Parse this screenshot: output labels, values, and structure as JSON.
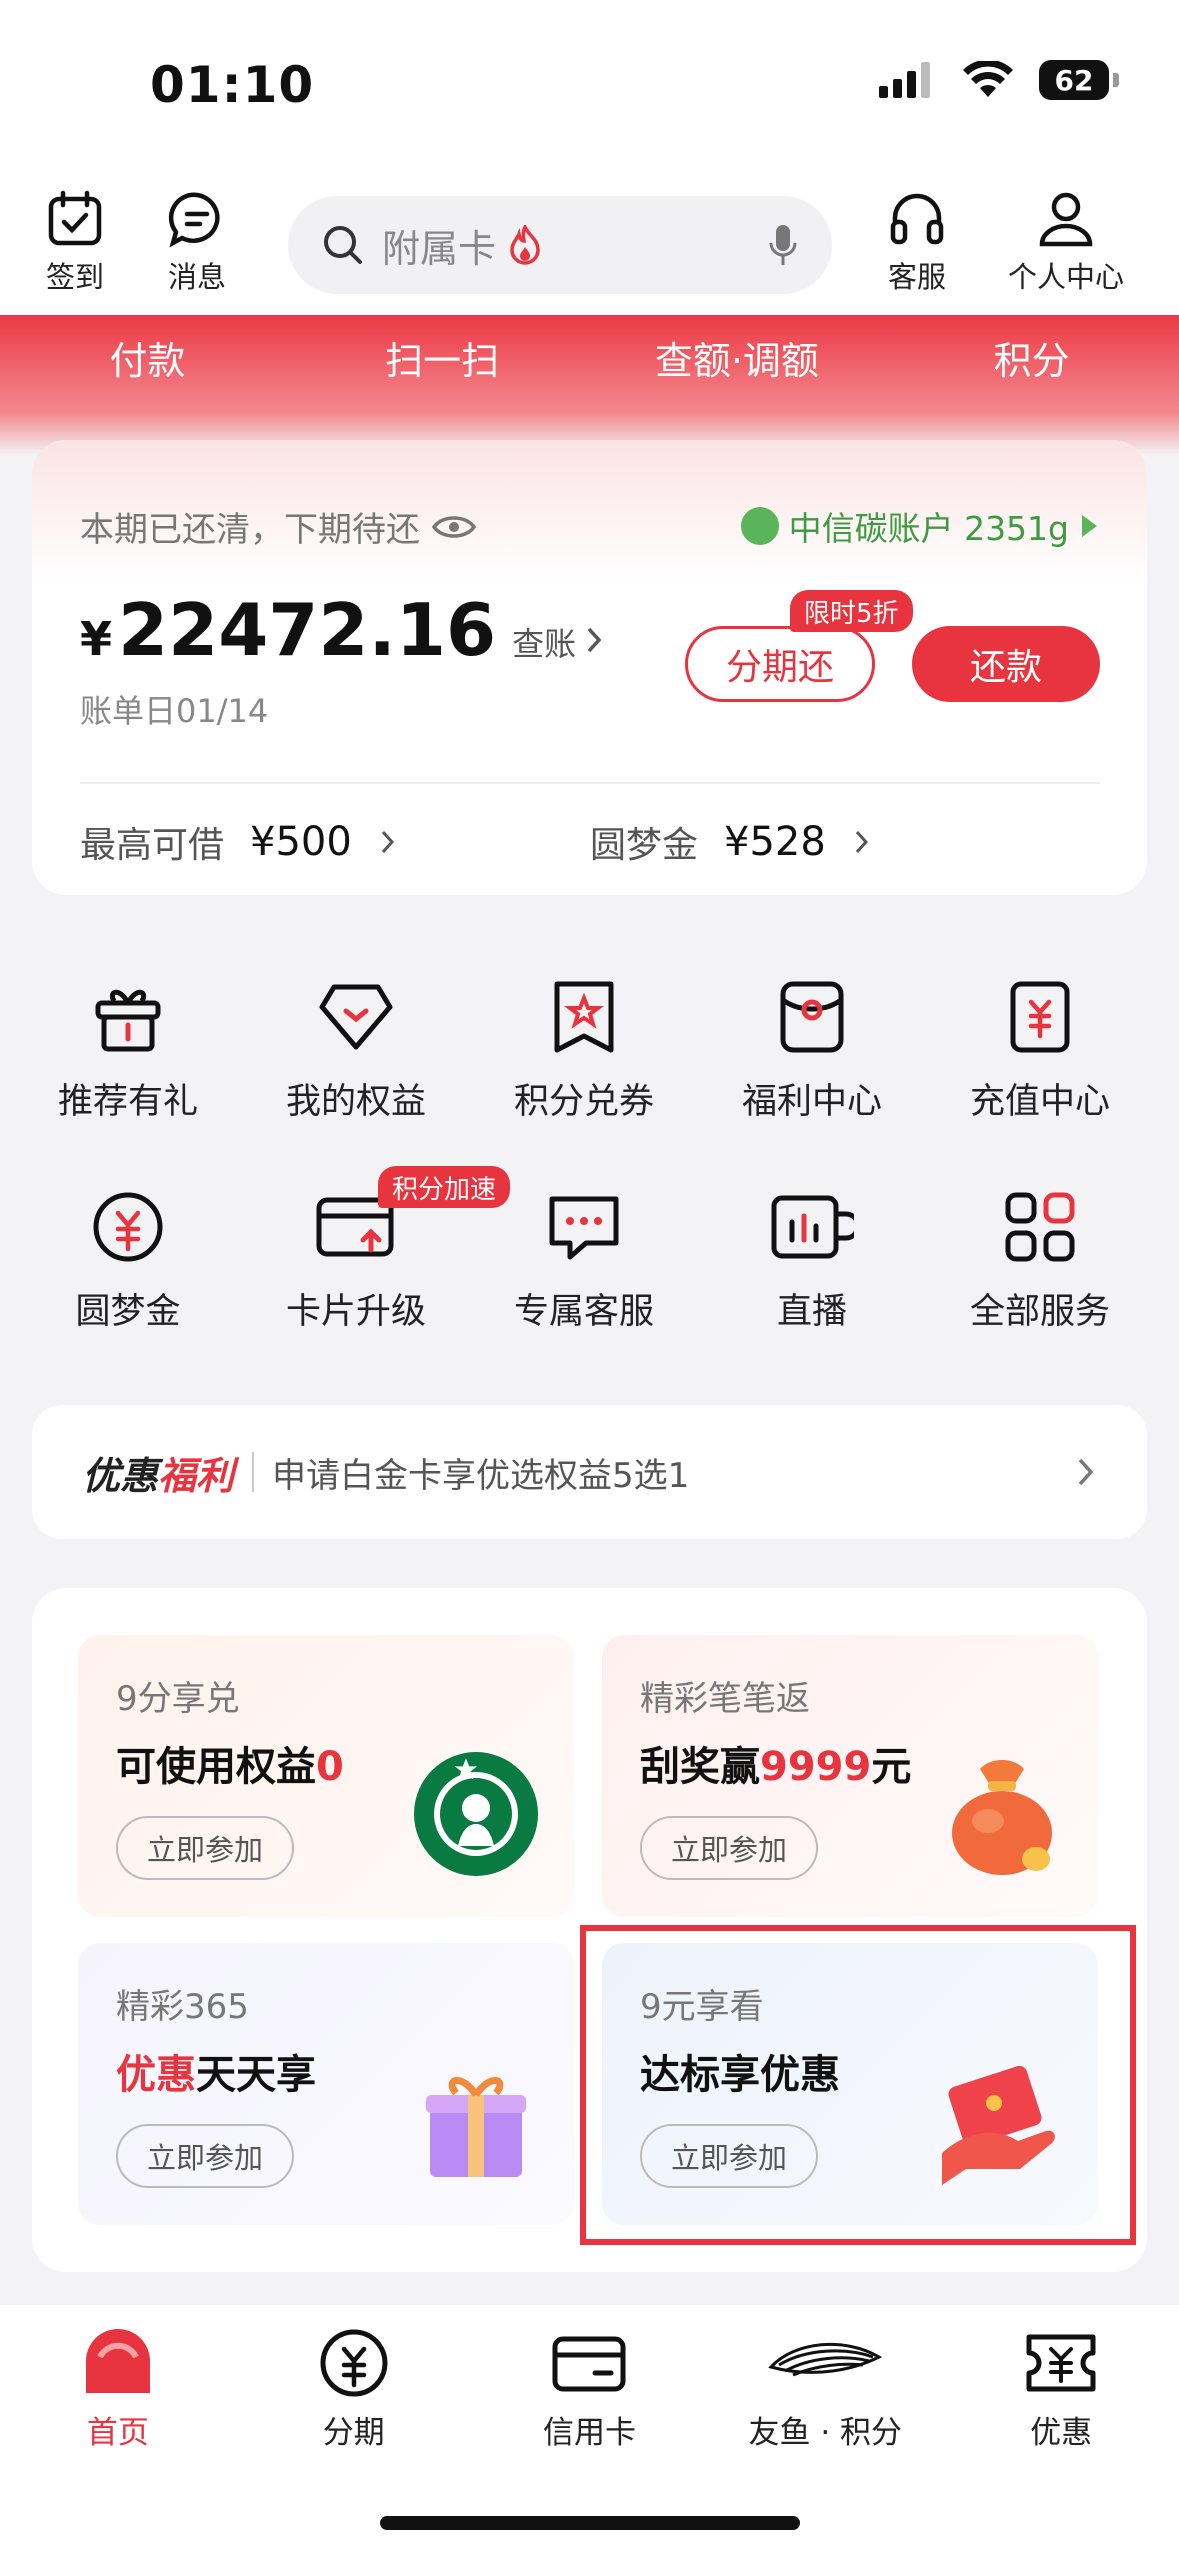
{
  "status": {
    "time": "01:10",
    "battery": "62"
  },
  "header": {
    "signin_label": "签到",
    "messages_label": "消息",
    "search_placeholder": "附属卡",
    "service_label": "客服",
    "profile_label": "个人中心"
  },
  "quick_tabs": [
    "付款",
    "扫一扫",
    "查额·调额",
    "积分"
  ],
  "bill": {
    "status_text": "本期已还清，下期待还",
    "carbon_label": "中信碳账户 2351g",
    "currency": "¥",
    "amount": "22472.16",
    "check_label": "查账",
    "bill_date": "账单日01/14",
    "promo_tag": "限时5折",
    "installment_label": "分期还",
    "repay_label": "还款",
    "max_borrow_label": "最高可借",
    "max_borrow_value": "¥500",
    "dream_fund_label": "圆梦金",
    "dream_fund_value": "¥528"
  },
  "services": [
    {
      "label": "推荐有礼",
      "icon": "gift-box-icon"
    },
    {
      "label": "我的权益",
      "icon": "diamond-icon"
    },
    {
      "label": "积分兑券",
      "icon": "star-coupon-icon"
    },
    {
      "label": "福利中心",
      "icon": "red-envelope-icon"
    },
    {
      "label": "充值中心",
      "icon": "yuan-card-icon"
    },
    {
      "label": "圆梦金",
      "icon": "yuan-coin-icon"
    },
    {
      "label": "卡片升级",
      "icon": "card-upgrade-icon",
      "badge": "积分加速"
    },
    {
      "label": "专属客服",
      "icon": "chat-bubble-icon"
    },
    {
      "label": "直播",
      "icon": "live-cup-icon"
    },
    {
      "label": "全部服务",
      "icon": "grid-icon"
    }
  ],
  "banner": {
    "title_a": "优惠",
    "title_b": "福利",
    "text": "申请白金卡享优选权益5选1"
  },
  "activities": [
    {
      "small": "9分享兑",
      "big_a": "可使用权益",
      "big_red": "0",
      "big_b": "",
      "join": "立即参加",
      "icon": "starbucks-logo-icon"
    },
    {
      "small": "精彩笔笔返",
      "big_a": "刮奖赢",
      "big_red": "9999",
      "big_b": "元",
      "join": "立即参加",
      "icon": "money-bag-icon"
    },
    {
      "small": "精彩365",
      "big_red_first": "优惠",
      "big_b": "天天享",
      "join": "立即参加",
      "icon": "gift-icon"
    },
    {
      "small": "9元享看",
      "big_a": "达标享优惠",
      "join": "立即参加",
      "icon": "hand-red-envelope-icon"
    }
  ],
  "bottom_nav": [
    {
      "label": "首页",
      "icon": "home-icon",
      "active": true
    },
    {
      "label": "分期",
      "icon": "yuan-circle-icon"
    },
    {
      "label": "信用卡",
      "icon": "credit-card-icon"
    },
    {
      "label": "友鱼 · 积分",
      "icon": "fish-icon"
    },
    {
      "label": "优惠",
      "icon": "ticket-icon"
    }
  ],
  "colors": {
    "brand_red": "#e8343f",
    "carbon_green": "#3e9b3f"
  }
}
